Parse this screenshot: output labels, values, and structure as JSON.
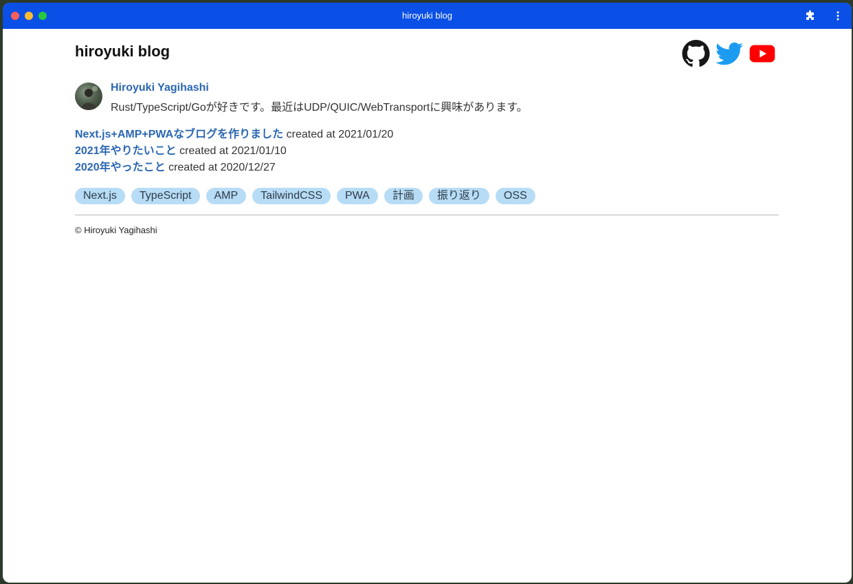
{
  "window": {
    "title": "hiroyuki blog",
    "buttons": [
      "close",
      "minimize",
      "maximize"
    ],
    "extension_icon": "puzzle-icon",
    "menu_icon": "more-vertical-icon"
  },
  "header": {
    "site_title": "hiroyuki blog",
    "social": [
      {
        "name": "github-icon",
        "color": "#181717"
      },
      {
        "name": "twitter-icon",
        "color": "#1d9bf0"
      },
      {
        "name": "youtube-icon",
        "color": "#ff0000"
      }
    ]
  },
  "author": {
    "name": "Hiroyuki Yagihashi",
    "bio": "Rust/TypeScript/Goが好きです。最近はUDP/QUIC/WebTransportに興味があります。"
  },
  "posts": [
    {
      "title": "Next.js+AMP+PWAなブログを作りました",
      "date": "created at 2021/01/20"
    },
    {
      "title": "2021年やりたいこと",
      "date": "created at 2021/01/10"
    },
    {
      "title": "2020年やったこと",
      "date": "created at 2020/12/27"
    }
  ],
  "tags": [
    "Next.js",
    "TypeScript",
    "AMP",
    "TailwindCSS",
    "PWA",
    "計画",
    "振り返り",
    "OSS"
  ],
  "footer": {
    "copyright": "© Hiroyuki Yagihashi"
  },
  "colors": {
    "titlebar": "#0a4fe6",
    "link": "#2a66b2",
    "tag_bg": "#b7dcf5"
  }
}
